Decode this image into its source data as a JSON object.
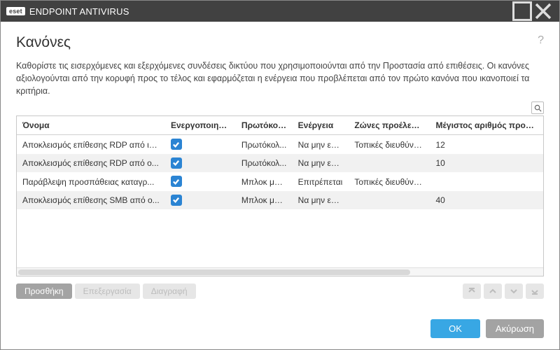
{
  "titlebar": {
    "brand_logo": "eset",
    "brand_text": "ENDPOINT ANTIVIRUS"
  },
  "page": {
    "title": "Κανόνες",
    "description": "Καθορίστε τις εισερχόμενες και εξερχόμενες συνδέσεις δικτύου που χρησιμοποιούνται από την Προστασία από επιθέσεις. Οι κανόνες αξιολογούνται από την κορυφή προς το τέλος και εφαρμόζεται η ενέργεια που προβλέπεται από τον πρώτο κανόνα που ικανοποιεί τα κριτήρια."
  },
  "columns": {
    "name": "Όνομα",
    "enabled": "Ενεργοποιημένο",
    "protocol": "Πρωτόκολλο",
    "action": "Ενέργεια",
    "zone": "Ζώνες προέλευσης",
    "max": "Μέγιστος αριθμός προσπαθε"
  },
  "rows": [
    {
      "name": "Αποκλεισμός επίθεσης RDP από ιδ...",
      "enabled": true,
      "protocol": "Πρωτόκολ...",
      "action": "Να μην επιτ...",
      "zone": "Τοπικές διευθύνσε...",
      "max": "12"
    },
    {
      "name": "Αποκλεισμός επίθεσης RDP από ο...",
      "enabled": true,
      "protocol": "Πρωτόκολ...",
      "action": "Να μην επιτ...",
      "zone": "",
      "max": "10"
    },
    {
      "name": "Παράβλεψη προσπάθειας καταγρ...",
      "enabled": true,
      "protocol": "Μπλοκ μην...",
      "action": "Επιτρέπεται",
      "zone": "Τοπικές διευθύνσε...",
      "max": ""
    },
    {
      "name": "Αποκλεισμός επίθεσης SMB από ο...",
      "enabled": true,
      "protocol": "Μπλοκ μην...",
      "action": "Να μην επιτ...",
      "zone": "",
      "max": "40"
    }
  ],
  "buttons": {
    "add": "Προσθήκη",
    "edit": "Επεξεργασία",
    "delete": "Διαγραφή",
    "ok": "OK",
    "cancel": "Ακύρωση"
  }
}
